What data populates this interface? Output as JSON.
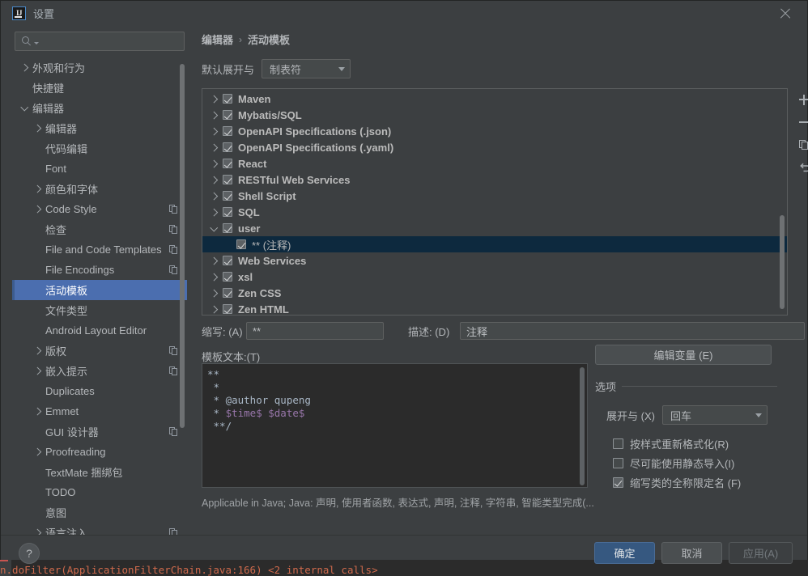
{
  "background": {
    "console_text": "n.doFilter(ApplicationFilterChain.java:166) <2 internal calls>"
  },
  "titlebar": {
    "logo_text": "IJ",
    "title": "设置",
    "close_label": "×"
  },
  "sidebar": {
    "search_placeholder": "",
    "items": [
      {
        "label": "外观和行为",
        "arrow": "right",
        "indent": 0,
        "copy": false,
        "selected": false
      },
      {
        "label": "快捷键",
        "arrow": "none",
        "indent": 0,
        "copy": false,
        "selected": false
      },
      {
        "label": "编辑器",
        "arrow": "down",
        "indent": 0,
        "copy": false,
        "selected": false
      },
      {
        "label": "编辑器",
        "arrow": "right",
        "indent": 1,
        "copy": false,
        "selected": false
      },
      {
        "label": "代码编辑",
        "arrow": "none",
        "indent": 1,
        "copy": false,
        "selected": false
      },
      {
        "label": "Font",
        "arrow": "none",
        "indent": 1,
        "copy": false,
        "selected": false
      },
      {
        "label": "颜色和字体",
        "arrow": "right",
        "indent": 1,
        "copy": false,
        "selected": false
      },
      {
        "label": "Code Style",
        "arrow": "right",
        "indent": 1,
        "copy": true,
        "selected": false
      },
      {
        "label": "检查",
        "arrow": "none",
        "indent": 1,
        "copy": true,
        "selected": false
      },
      {
        "label": "File and Code Templates",
        "arrow": "none",
        "indent": 1,
        "copy": true,
        "selected": false
      },
      {
        "label": "File Encodings",
        "arrow": "none",
        "indent": 1,
        "copy": true,
        "selected": false
      },
      {
        "label": "活动模板",
        "arrow": "none",
        "indent": 1,
        "copy": false,
        "selected": true
      },
      {
        "label": "文件类型",
        "arrow": "none",
        "indent": 1,
        "copy": false,
        "selected": false
      },
      {
        "label": "Android Layout Editor",
        "arrow": "none",
        "indent": 1,
        "copy": false,
        "selected": false
      },
      {
        "label": "版权",
        "arrow": "right",
        "indent": 1,
        "copy": true,
        "selected": false
      },
      {
        "label": "嵌入提示",
        "arrow": "right",
        "indent": 1,
        "copy": true,
        "selected": false
      },
      {
        "label": "Duplicates",
        "arrow": "none",
        "indent": 1,
        "copy": false,
        "selected": false
      },
      {
        "label": "Emmet",
        "arrow": "right",
        "indent": 1,
        "copy": false,
        "selected": false
      },
      {
        "label": "GUI 设计器",
        "arrow": "none",
        "indent": 1,
        "copy": true,
        "selected": false
      },
      {
        "label": "Proofreading",
        "arrow": "right",
        "indent": 1,
        "copy": false,
        "selected": false
      },
      {
        "label": "TextMate 捆绑包",
        "arrow": "none",
        "indent": 1,
        "copy": false,
        "selected": false
      },
      {
        "label": "TODO",
        "arrow": "none",
        "indent": 1,
        "copy": false,
        "selected": false
      },
      {
        "label": "意图",
        "arrow": "none",
        "indent": 1,
        "copy": false,
        "selected": false
      },
      {
        "label": "语言注入",
        "arrow": "right",
        "indent": 1,
        "copy": true,
        "selected": false
      }
    ]
  },
  "content": {
    "breadcrumb": {
      "parent": "编辑器",
      "separator": "›",
      "current": "活动模板"
    },
    "expand_with": {
      "label": "默认展开与",
      "value": "制表符"
    },
    "template_tree": [
      {
        "label": "Maven",
        "arrow": "right",
        "checked": true,
        "indent": 0,
        "selected": false,
        "bold": true
      },
      {
        "label": "Mybatis/SQL",
        "arrow": "right",
        "checked": true,
        "indent": 0,
        "selected": false,
        "bold": true
      },
      {
        "label": "OpenAPI Specifications (.json)",
        "arrow": "right",
        "checked": true,
        "indent": 0,
        "selected": false,
        "bold": true
      },
      {
        "label": "OpenAPI Specifications (.yaml)",
        "arrow": "right",
        "checked": true,
        "indent": 0,
        "selected": false,
        "bold": true
      },
      {
        "label": "React",
        "arrow": "right",
        "checked": true,
        "indent": 0,
        "selected": false,
        "bold": true
      },
      {
        "label": "RESTful Web Services",
        "arrow": "right",
        "checked": true,
        "indent": 0,
        "selected": false,
        "bold": true
      },
      {
        "label": "Shell Script",
        "arrow": "right",
        "checked": true,
        "indent": 0,
        "selected": false,
        "bold": true
      },
      {
        "label": "SQL",
        "arrow": "right",
        "checked": true,
        "indent": 0,
        "selected": false,
        "bold": true
      },
      {
        "label": "user",
        "arrow": "down",
        "checked": true,
        "indent": 0,
        "selected": false,
        "bold": true
      },
      {
        "label": "** (注释)",
        "arrow": "none",
        "checked": true,
        "indent": 1,
        "selected": true,
        "bold": false
      },
      {
        "label": "Web Services",
        "arrow": "right",
        "checked": true,
        "indent": 0,
        "selected": false,
        "bold": true
      },
      {
        "label": "xsl",
        "arrow": "right",
        "checked": true,
        "indent": 0,
        "selected": false,
        "bold": true
      },
      {
        "label": "Zen CSS",
        "arrow": "right",
        "checked": true,
        "indent": 0,
        "selected": false,
        "bold": true
      },
      {
        "label": "Zen HTML",
        "arrow": "right",
        "checked": true,
        "indent": 0,
        "selected": false,
        "bold": true
      }
    ],
    "mini_toolbar": [
      {
        "icon": "plus-icon",
        "title": "添加"
      },
      {
        "icon": "minus-icon",
        "title": "移除"
      },
      {
        "icon": "copy-icon",
        "title": "复制"
      },
      {
        "icon": "revert-icon",
        "title": "还原"
      }
    ],
    "abbreviation": {
      "label": "缩写: (A)",
      "value": "**"
    },
    "description": {
      "label": "描述: (D)",
      "value": "注释"
    },
    "template_text": {
      "label": "模板文本:(T)",
      "lines": [
        {
          "text": "**",
          "var": ""
        },
        {
          "text": " *",
          "var": ""
        },
        {
          "text": " * @author qupeng",
          "var": ""
        },
        {
          "text": " * ",
          "var": "$time$ $date$"
        },
        {
          "text": " **/",
          "var": ""
        }
      ]
    },
    "edit_variables_button": "编辑变量 (E)",
    "options": {
      "title": "选项",
      "expand_with": {
        "label": "展开与 (X)",
        "value": "回车"
      },
      "checkboxes": [
        {
          "label": "按样式重新格式化(R)",
          "checked": false
        },
        {
          "label": "尽可能使用静态导入(I)",
          "checked": false
        },
        {
          "label": "缩写类的全称限定名 (F)",
          "checked": true
        }
      ]
    },
    "applicable_text": "Applicable in Java; Java: 声明, 使用者函数, 表达式, 声明, 注释, 字符串, 智能类型完成(..."
  },
  "footer": {
    "help_label": "?",
    "ok": "确定",
    "cancel": "取消",
    "apply": "应用(A)"
  },
  "colors": {
    "accent_selected": "#4b6eaf",
    "list_selected": "#0d293e",
    "ok_button": "#365880",
    "panel_bg": "#3c3f41",
    "editor_bg": "#2b2b2b",
    "variable_text": "#9876aa"
  }
}
